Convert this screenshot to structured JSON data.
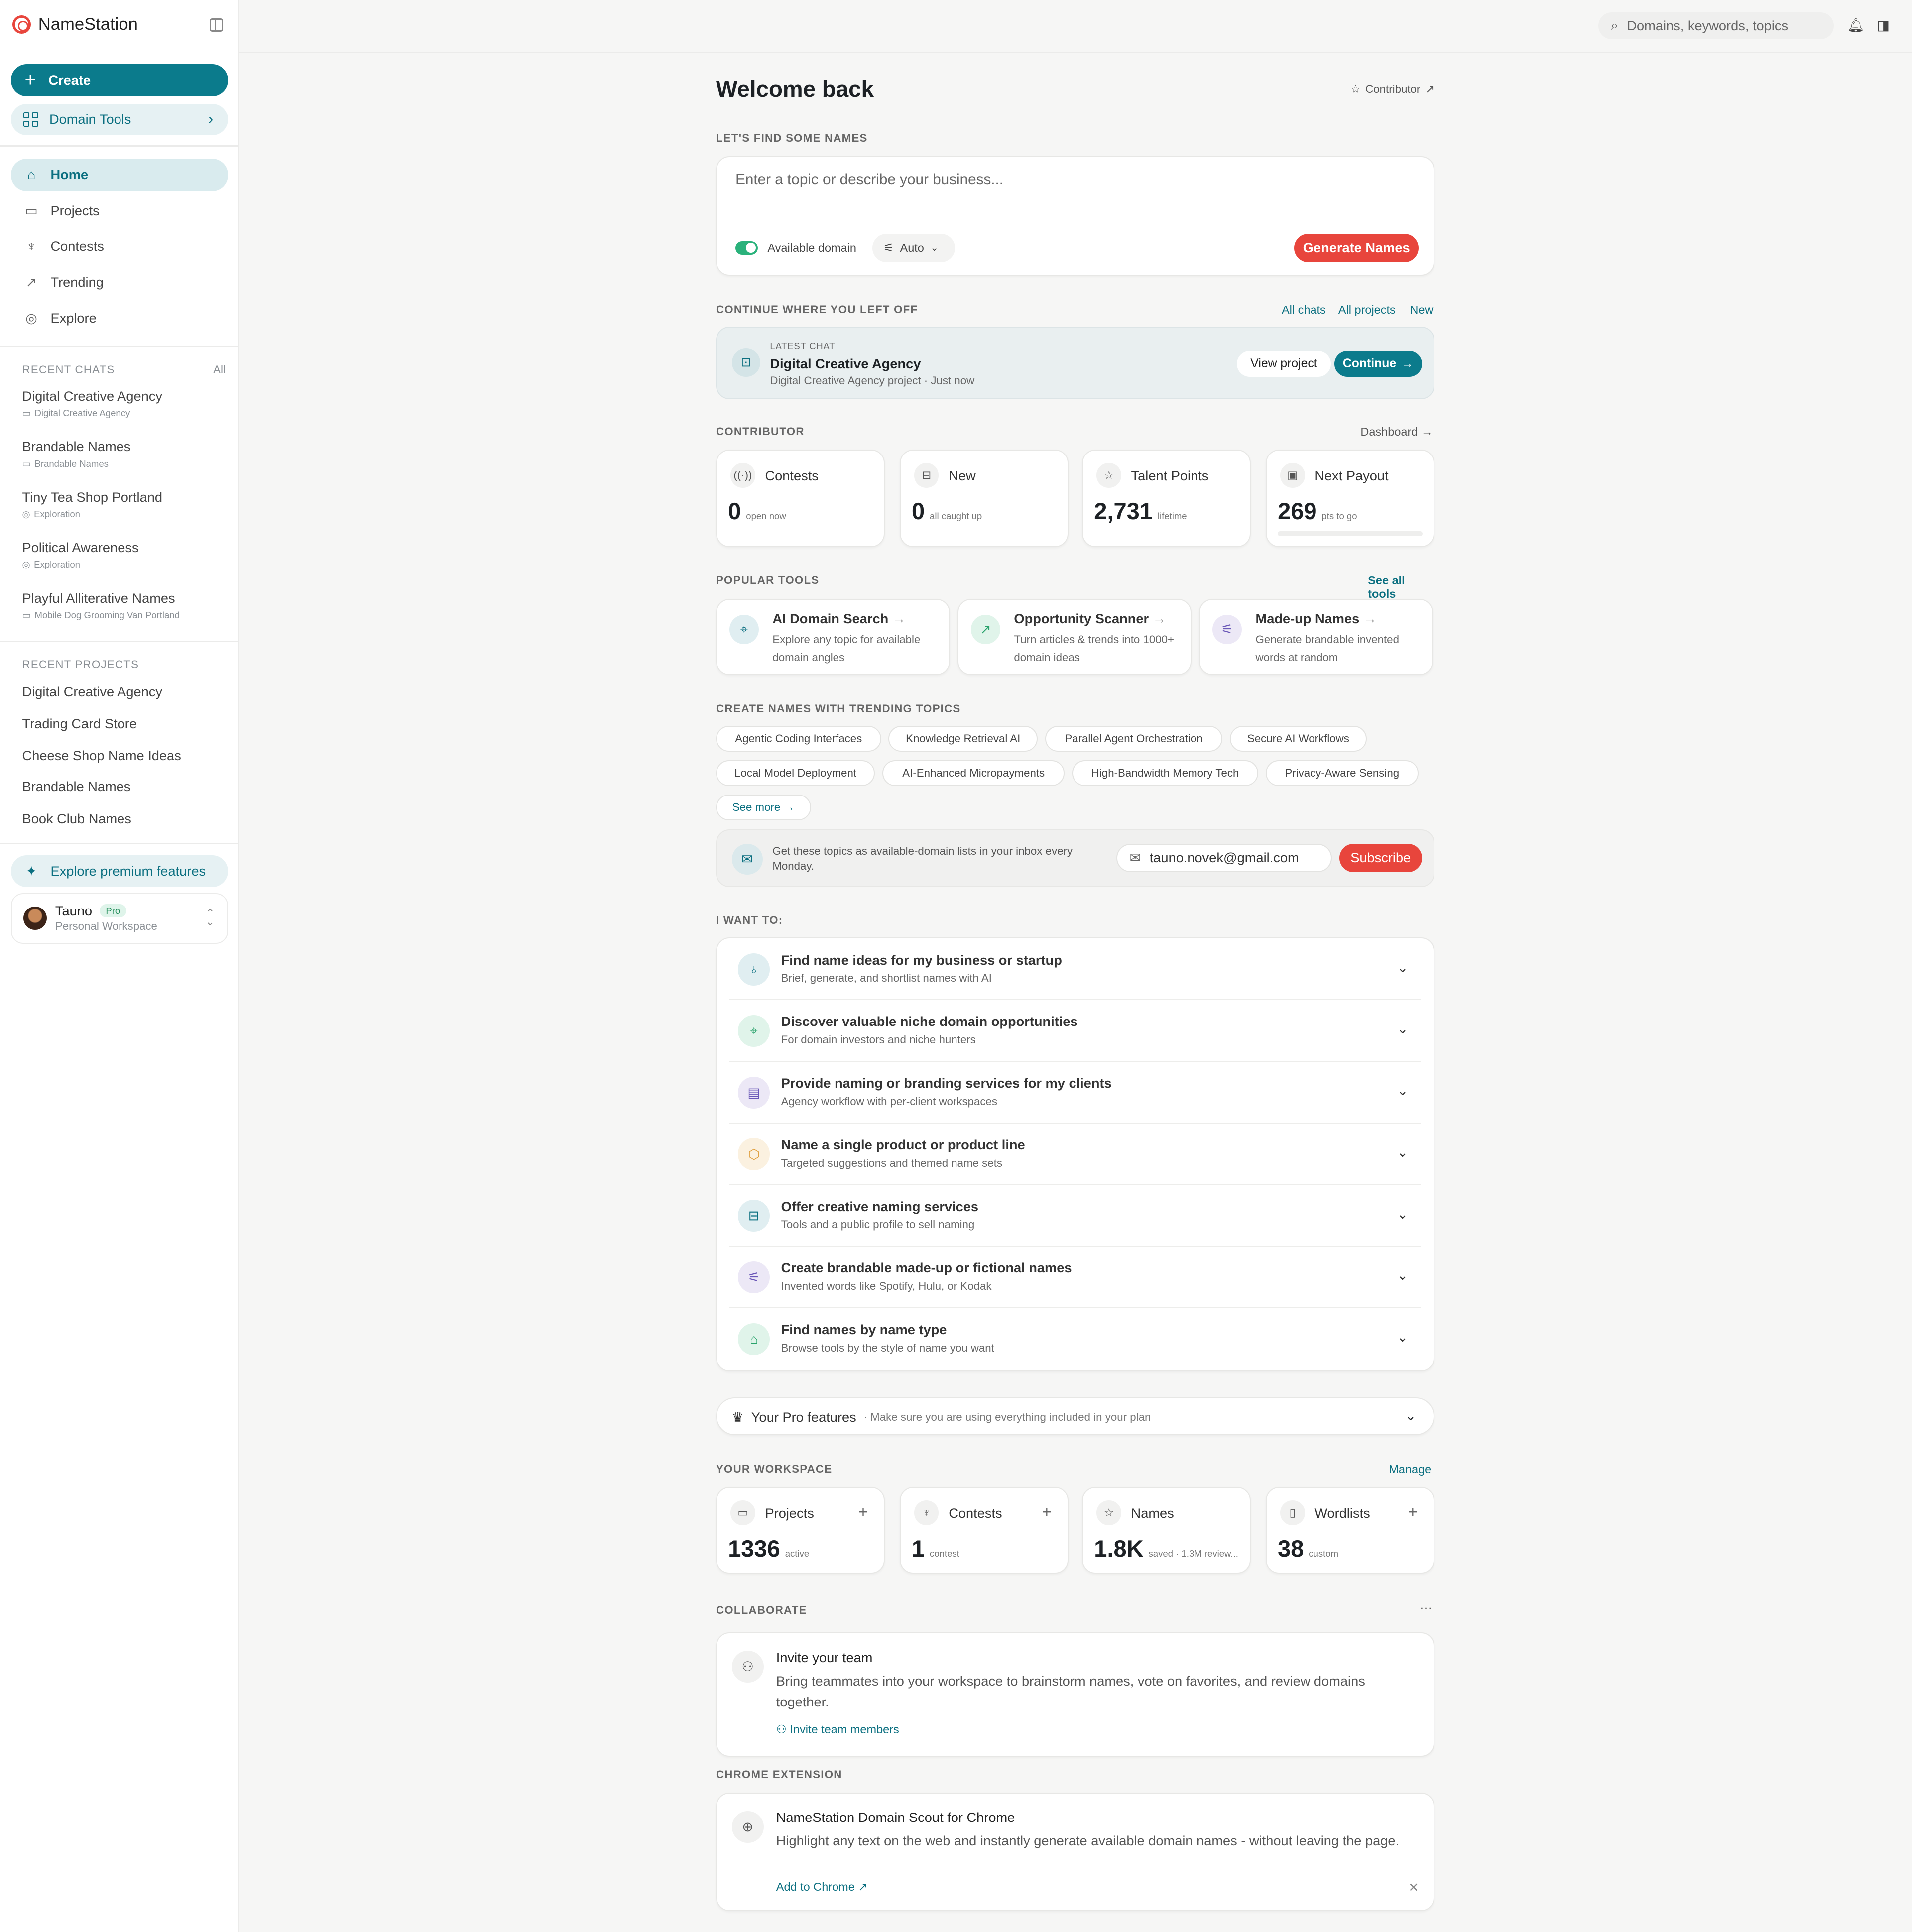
{
  "app": {
    "name": "NameStation"
  },
  "sidebar": {
    "create_label": "Create",
    "tools_label": "Domain Tools",
    "nav": [
      {
        "label": "Home",
        "icon": "home-icon"
      },
      {
        "label": "Projects",
        "icon": "folder-icon"
      },
      {
        "label": "Contests",
        "icon": "trophy-icon"
      },
      {
        "label": "Trending",
        "icon": "trending-icon"
      },
      {
        "label": "Explore",
        "icon": "compass-icon"
      }
    ],
    "recent_chats_label": "RECENT CHATS",
    "recent_chats_all": "All",
    "recent_chats": [
      {
        "title": "Digital Creative Agency",
        "sub": "Digital Creative Agency"
      },
      {
        "title": "Brandable Names",
        "sub": "Brandable Names"
      },
      {
        "title": "Tiny Tea Shop Portland",
        "sub": "Exploration"
      },
      {
        "title": "Political Awareness",
        "sub": "Exploration"
      },
      {
        "title": "Playful Alliterative Names",
        "sub": "Mobile Dog Grooming Van Portland"
      }
    ],
    "recent_projects_label": "RECENT PROJECTS",
    "recent_projects": [
      "Digital Creative Agency",
      "Trading Card Store",
      "Cheese Shop Name Ideas",
      "Brandable Names",
      "Book Club Names"
    ],
    "premium_label": "Explore premium features",
    "user": {
      "name": "Tauno",
      "badge": "Pro",
      "workspace": "Personal Workspace"
    }
  },
  "topbar": {
    "search_placeholder": "Domains, keywords, topics"
  },
  "main": {
    "title": "Welcome back",
    "contributor_link": "Contributor",
    "find_label": "LET'S FIND SOME NAMES",
    "prompt_placeholder": "Enter a topic or describe your business...",
    "available_domain": "Available domain",
    "auto": "Auto",
    "generate": "Generate Names",
    "continue_label": "CONTINUE WHERE YOU LEFT OFF",
    "links": {
      "all_chats": "All chats",
      "all_projects": "All projects",
      "new": "New"
    },
    "latest": {
      "label": "LATEST CHAT",
      "title": "Digital Creative Agency",
      "sub": "Digital Creative Agency project · Just now",
      "view": "View project",
      "continue": "Continue"
    },
    "contributor_label": "CONTRIBUTOR",
    "dashboard": "Dashboard",
    "contrib_stats": [
      {
        "name": "Contests",
        "value": "0",
        "unit": "open now",
        "icon": "broadcast-icon"
      },
      {
        "name": "New",
        "value": "0",
        "unit": "all caught up",
        "icon": "inbox-icon"
      },
      {
        "name": "Talent Points",
        "value": "2,731",
        "unit": "lifetime",
        "icon": "star-icon"
      },
      {
        "name": "Next Payout",
        "value": "269",
        "unit": "pts to go",
        "icon": "payout-icon"
      }
    ],
    "tools_label": "POPULAR TOOLS",
    "see_all_tools": "See all tools",
    "tools": [
      {
        "title": "AI Domain Search",
        "desc": "Explore any topic for available domain angles",
        "icon": "telescope-icon"
      },
      {
        "title": "Opportunity Scanner",
        "desc": "Turn articles & trends into 1000+ domain ideas",
        "icon": "trend-up-icon"
      },
      {
        "title": "Made-up Names",
        "desc": "Generate brandable invented words at random",
        "icon": "magic-wand-icon"
      }
    ],
    "trending_label": "CREATE NAMES WITH TRENDING TOPICS",
    "chips": [
      "Agentic Coding Interfaces",
      "Knowledge Retrieval AI",
      "Parallel Agent Orchestration",
      "Secure AI Workflows",
      "Local Model Deployment",
      "AI-Enhanced Micropayments",
      "High-Bandwidth Memory Tech",
      "Privacy-Aware Sensing"
    ],
    "see_more": "See more",
    "newsletter": {
      "text": "Get these topics as available-domain lists in your inbox every Monday.",
      "email": "tauno.novek@gmail.com",
      "subscribe": "Subscribe"
    },
    "want_label": "I WANT TO:",
    "wants": [
      {
        "title": "Find name ideas for my business or startup",
        "sub": "Brief, generate, and shortlist names with AI",
        "icon": "lightbulb-icon"
      },
      {
        "title": "Discover valuable niche domain opportunities",
        "sub": "For domain investors and niche hunters",
        "icon": "telescope-icon"
      },
      {
        "title": "Provide naming or branding services for my clients",
        "sub": "Agency workflow with per-client workspaces",
        "icon": "briefcase-icon"
      },
      {
        "title": "Name a single product or product line",
        "sub": "Targeted suggestions and themed name sets",
        "icon": "box-icon"
      },
      {
        "title": "Offer creative naming services",
        "sub": "Tools and a public profile to sell naming",
        "icon": "store-icon"
      },
      {
        "title": "Create brandable made-up or fictional names",
        "sub": "Invented words like Spotify, Hulu, or Kodak",
        "icon": "magic-wand-icon"
      },
      {
        "title": "Find names by name type",
        "sub": "Browse tools by the style of name you want",
        "icon": "tag-icon"
      }
    ],
    "pro": {
      "title": "Your Pro features",
      "sub": "· Make sure you are using everything included in your plan"
    },
    "workspace_label": "YOUR WORKSPACE",
    "manage": "Manage",
    "workspace": [
      {
        "name": "Projects",
        "value": "1336",
        "unit": "active",
        "icon": "folder-icon"
      },
      {
        "name": "Contests",
        "value": "1",
        "unit": "contest",
        "icon": "trophy-icon"
      },
      {
        "name": "Names",
        "value": "1.8K",
        "unit": "saved · 1.3M review...",
        "icon": "star-icon"
      },
      {
        "name": "Wordlists",
        "value": "38",
        "unit": "custom",
        "icon": "book-icon"
      }
    ],
    "collab_label": "COLLABORATE",
    "collab": {
      "title": "Invite your team",
      "desc": "Bring teammates into your workspace to brainstorm names, vote on favorites, and review domains together.",
      "link": "Invite team members"
    },
    "chrome_label": "CHROME EXTENSION",
    "chrome": {
      "title": "NameStation Domain Scout for Chrome",
      "desc": "Highlight any text on the web and instantly generate available domain names - without leaving the page.",
      "link": "Add to Chrome"
    },
    "more": "···"
  }
}
